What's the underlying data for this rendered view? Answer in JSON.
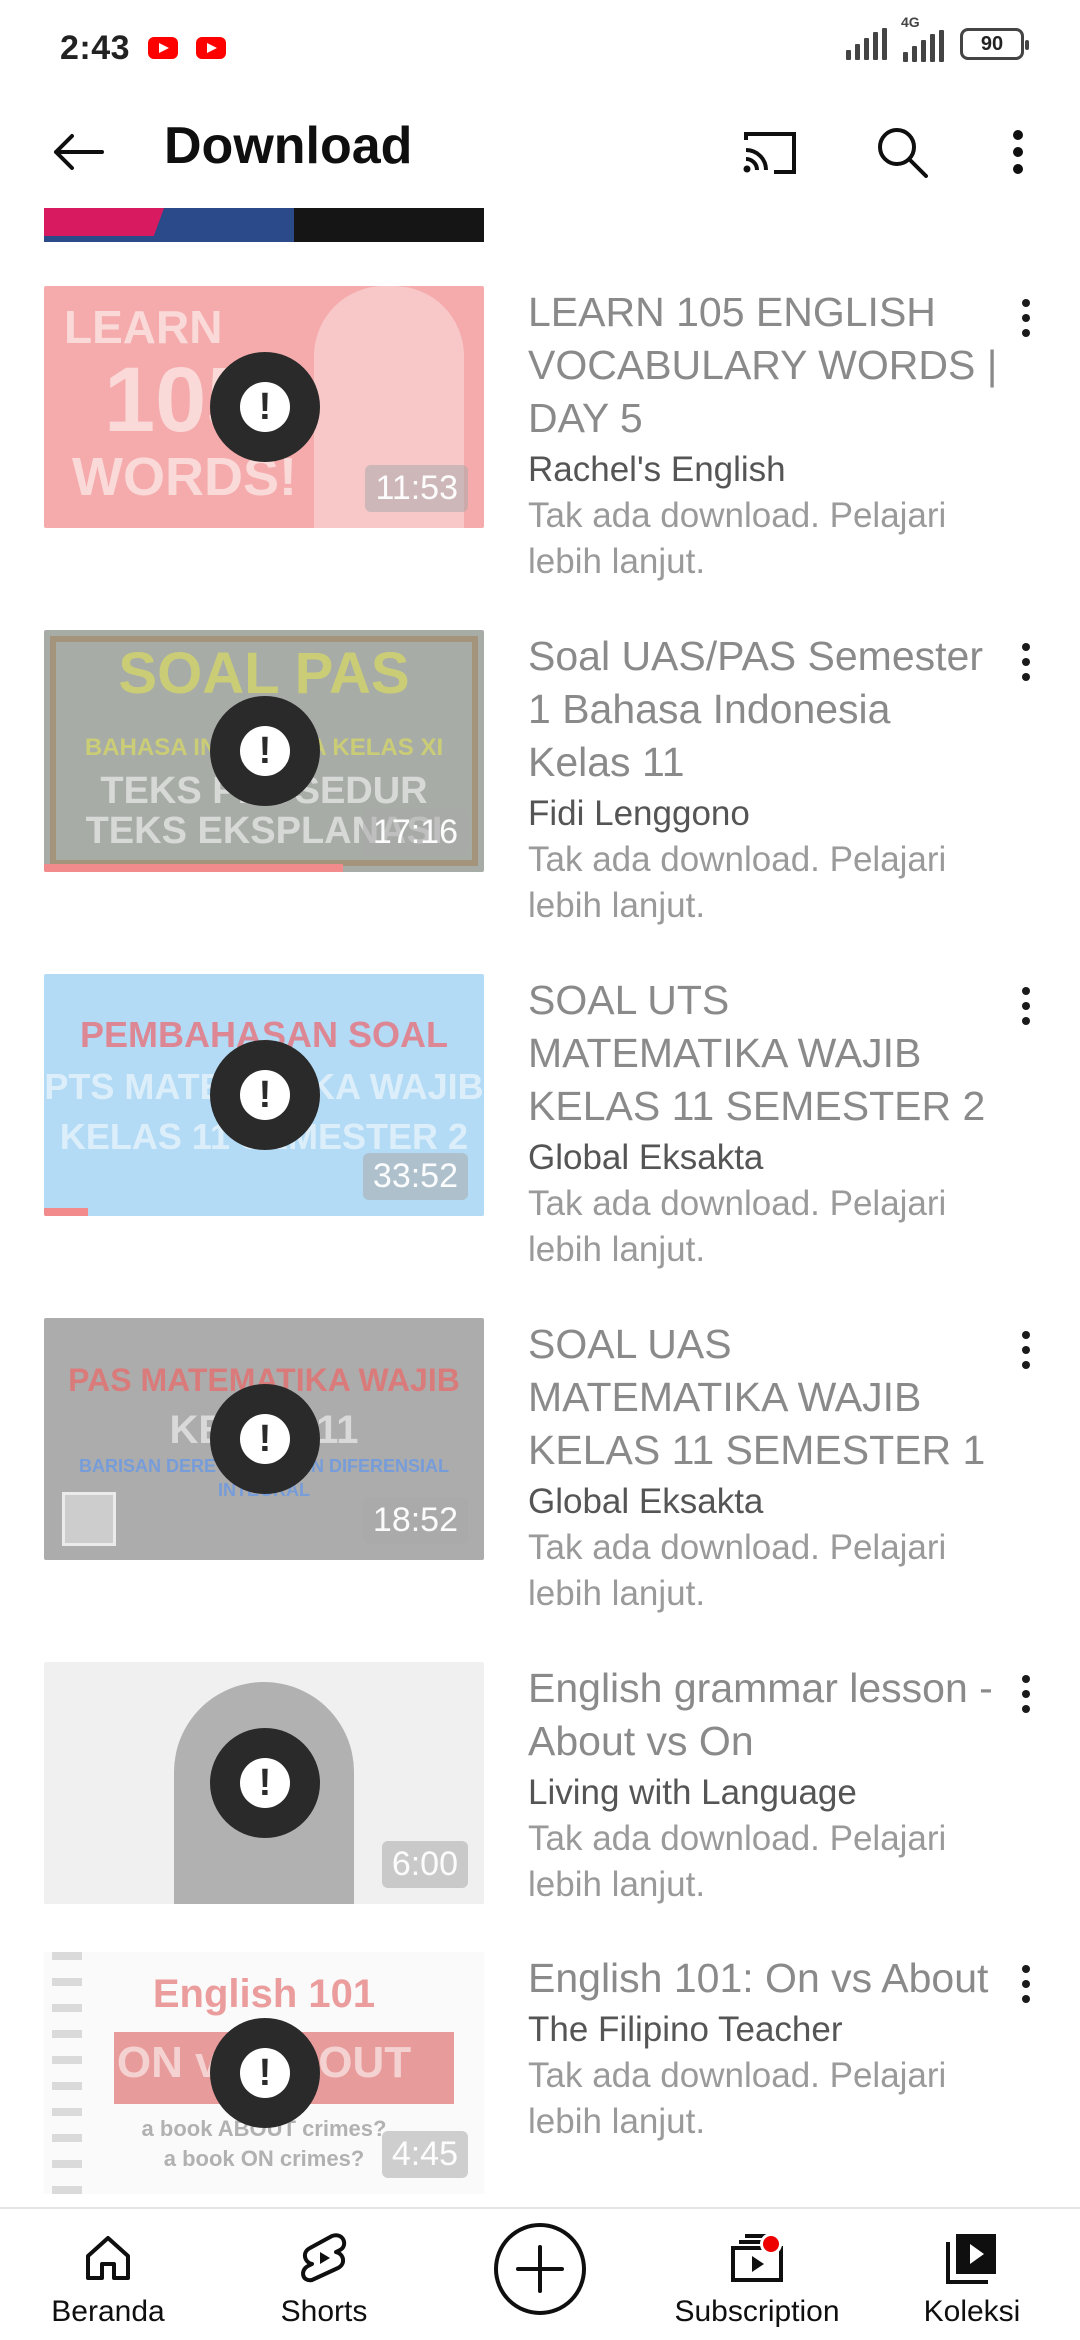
{
  "status_bar": {
    "time": "2:43",
    "network": "4G",
    "battery": "90"
  },
  "header": {
    "title": "Download",
    "icons": [
      "back-arrow-icon",
      "cast-icon",
      "search-icon",
      "more-vert-icon"
    ]
  },
  "videos": [
    {
      "title": "LEARN 105 ENGLISH VOCABULARY WORDS | DAY 5",
      "channel": "Rachel's English",
      "status": "Tak ada download. Pelajari lebih lanjut.",
      "duration": "11:53",
      "thumb_text": [
        "LEARN",
        "105",
        "WORDS!"
      ],
      "thumb_color": "#e8383a"
    },
    {
      "title": "Soal UAS/PAS Semester 1 Bahasa Indonesia Kelas 11",
      "channel": "Fidi Lenggono",
      "status": "Tak ada download. Pelajari lebih lanjut.",
      "duration": "17:16",
      "thumb_text": [
        "SOAL PAS",
        "BAHASA INDONESIA KELAS XI",
        "TEKS PROSEDUR",
        "TEKS EKSPLANASI"
      ],
      "thumb_color": "#1e2a1e",
      "progress_percent": 68
    },
    {
      "title": "SOAL UTS MATEMATIKA WAJIB KELAS 11 SEMESTER 2",
      "channel": "Global Eksakta",
      "status": "Tak ada download. Pelajari lebih lanjut.",
      "duration": "33:52",
      "thumb_text": [
        "PEMBAHASAN SOAL",
        "PTS MATEMATIKA WAJIB",
        "KELAS 11 SEMESTER 2"
      ],
      "thumb_color": "#4aa9e8",
      "progress_percent": 10
    },
    {
      "title": "SOAL UAS MATEMATIKA WAJIB KELAS 11 SEMESTER 1",
      "channel": "Global Eksakta",
      "status": "Tak ada download. Pelajari lebih lanjut.",
      "duration": "18:52",
      "thumb_text": [
        "PAS MATEMATIKA WAJIB",
        "KELAS 11",
        "BARISAN DERET, TURUNAN DIFERENSIAL",
        "INTEGRAL"
      ],
      "thumb_color": "#3a3a3a"
    },
    {
      "title": "English grammar lesson - About vs On",
      "channel": "Living with Language",
      "status": "Tak ada download. Pelajari lebih lanjut.",
      "duration": "6:00",
      "thumb_text": [],
      "thumb_color": "#d9d9d9"
    },
    {
      "title": "English 101: On vs About",
      "channel": "The Filipino Teacher",
      "status": "Tak ada download. Pelajari lebih lanjut.",
      "duration": "4:45",
      "thumb_text": [
        "English 101",
        "ON vs ABOUT",
        "a book ABOUT crimes?",
        "a book ON crimes?"
      ],
      "thumb_color": "#f2f2f2"
    }
  ],
  "bottom_nav": [
    {
      "label": "Beranda",
      "icon": "home-icon"
    },
    {
      "label": "Shorts",
      "icon": "shorts-icon"
    },
    {
      "label": "",
      "icon": "create-plus-icon"
    },
    {
      "label": "Subscription",
      "icon": "subscriptions-icon"
    },
    {
      "label": "Koleksi",
      "icon": "library-icon"
    }
  ]
}
